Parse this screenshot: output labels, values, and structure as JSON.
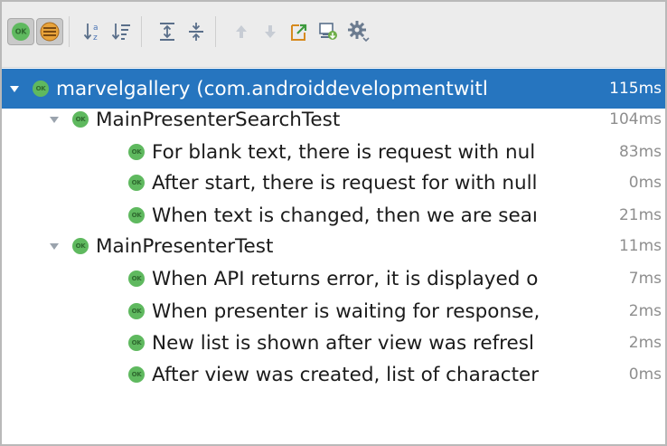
{
  "toolbar": {
    "buttons": [
      {
        "icon": "show-passed-icon",
        "pressed": true
      },
      {
        "icon": "show-ignored-icon",
        "pressed": true
      },
      {
        "icon": "sort-alphabetically-icon"
      },
      {
        "icon": "sort-by-duration-icon"
      },
      {
        "icon": "expand-all-icon"
      },
      {
        "icon": "collapse-all-icon"
      },
      {
        "icon": "previous-failed-icon"
      },
      {
        "icon": "next-failed-icon"
      },
      {
        "icon": "export-results-icon"
      },
      {
        "icon": "import-tests-icon"
      },
      {
        "icon": "settings-icon"
      }
    ]
  },
  "tree": {
    "root": {
      "label": "marvelgallery (com.androiddevelopmentwitl",
      "time": "115ms"
    },
    "suites": [
      {
        "label": "MainPresenterSearchTest",
        "time": "104ms",
        "tests": [
          {
            "label": "For blank text, there is request with nul",
            "time": "83ms"
          },
          {
            "label": "After start, there is request for with null",
            "time": "0ms"
          },
          {
            "label": "When text is changed, then we are seaı",
            "time": "21ms"
          }
        ]
      },
      {
        "label": "MainPresenterTest",
        "time": "11ms",
        "tests": [
          {
            "label": "When API returns error, it is displayed o",
            "time": "7ms"
          },
          {
            "label": "When presenter is waiting for response,",
            "time": "2ms"
          },
          {
            "label": "New list is shown after view was refresl",
            "time": "2ms"
          },
          {
            "label": "After view was created, list of character",
            "time": "0ms"
          }
        ]
      }
    ]
  },
  "colors": {
    "selection": "#2675bf",
    "ok_green": "#5fb95f",
    "time_gray": "#8e8e8e"
  }
}
